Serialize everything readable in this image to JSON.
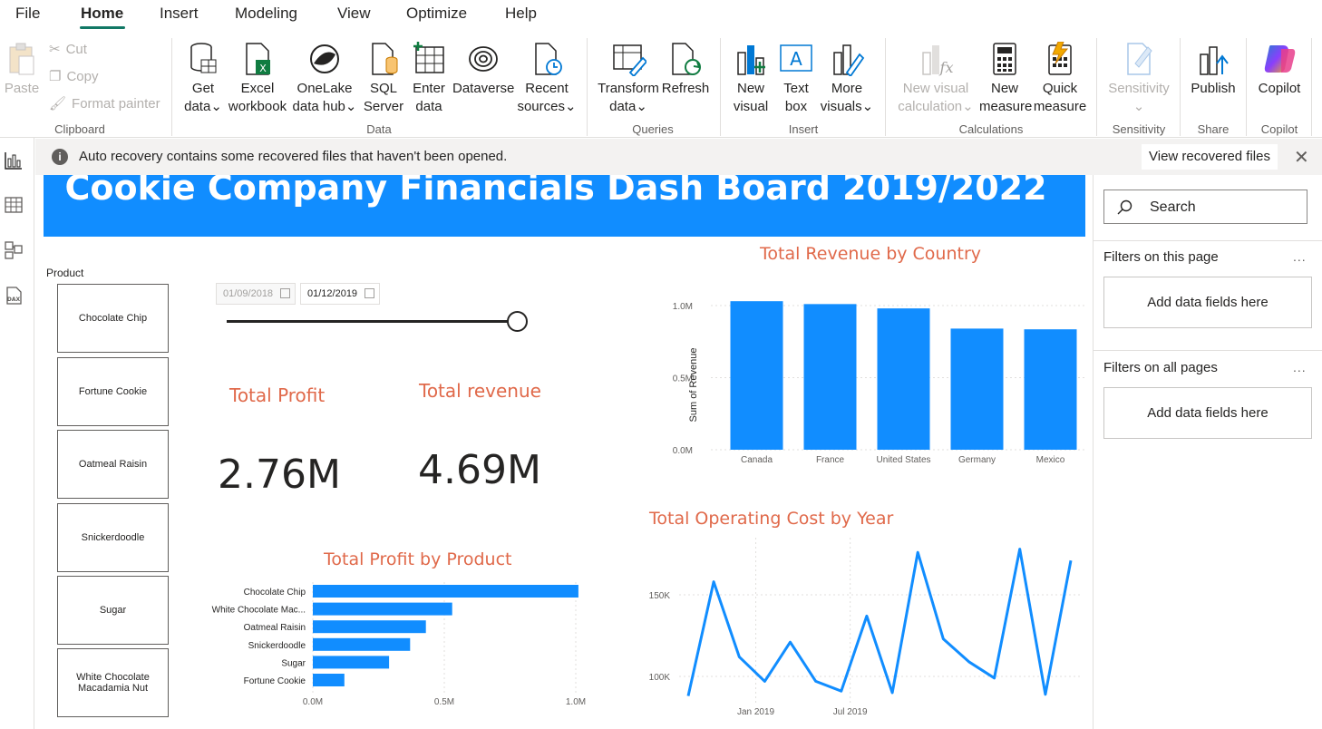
{
  "menu": {
    "items": [
      "File",
      "Home",
      "Insert",
      "Modeling",
      "View",
      "Optimize",
      "Help"
    ],
    "active": "Home"
  },
  "ribbon": {
    "clipboard": {
      "paste": "Paste",
      "cut": "Cut",
      "copy": "Copy",
      "format_painter": "Format painter",
      "group": "Clipboard"
    },
    "data": {
      "get_data": [
        "Get",
        "data"
      ],
      "excel": [
        "Excel",
        "workbook"
      ],
      "onelake": [
        "OneLake",
        "data hub"
      ],
      "sql": [
        "SQL",
        "Server"
      ],
      "enter": [
        "Enter",
        "data"
      ],
      "dataverse": "Dataverse",
      "recent": [
        "Recent",
        "sources"
      ],
      "group": "Data"
    },
    "queries": {
      "transform": [
        "Transform",
        "data"
      ],
      "refresh": "Refresh",
      "group": "Queries"
    },
    "insert": {
      "new_visual": [
        "New",
        "visual"
      ],
      "text_box": [
        "Text",
        "box"
      ],
      "more_visuals": [
        "More",
        "visuals"
      ],
      "group": "Insert"
    },
    "calculations": {
      "new_visual_calc": [
        "New visual",
        "calculation"
      ],
      "new_measure": [
        "New",
        "measure"
      ],
      "quick_measure": [
        "Quick",
        "measure"
      ],
      "group": "Calculations"
    },
    "sensitivity": {
      "label": "Sensitivity",
      "group": "Sensitivity"
    },
    "share": {
      "publish": "Publish",
      "group": "Share"
    },
    "copilot": {
      "label": "Copilot",
      "group": "Copilot"
    }
  },
  "notification": {
    "icon": "info-icon",
    "text": "Auto recovery contains some recovered files that haven't been opened.",
    "button": "View recovered files"
  },
  "report": {
    "title": "Cookie Company Financials Dash Board 2019/2022",
    "slicer": {
      "title": "Product",
      "items": [
        "Chocolate Chip",
        "Fortune Cookie",
        "Oatmeal Raisin",
        "Snickerdoodle",
        "Sugar",
        "White Chocolate Macadamia Nut"
      ]
    },
    "date_range": {
      "start": "01/09/2018",
      "end": "01/12/2019"
    },
    "cards": [
      {
        "title": "Total Profit",
        "value": "2.76M"
      },
      {
        "title": "Total revenue",
        "value": "4.69M"
      }
    ]
  },
  "pane": {
    "search": "Search",
    "filters_page": "Filters on this page",
    "filters_all": "Filters on all pages",
    "add_fields": "Add data fields here",
    "more": "..."
  },
  "colors": {
    "accent": "#118dff",
    "title": "#e0694a",
    "ribbon_underline": "#117865"
  },
  "chart_data": [
    {
      "type": "bar",
      "title": "Total Revenue by Country",
      "categories": [
        "Canada",
        "France",
        "United States",
        "Germany",
        "Mexico"
      ],
      "values": [
        1030000,
        1010000,
        980000,
        840000,
        835000
      ],
      "ylabel": "Sum of Revenue",
      "ylim": [
        0,
        1050000
      ],
      "yticks": [
        "0.0M",
        "0.5M",
        "1.0M"
      ],
      "grid": true
    },
    {
      "type": "bar",
      "orientation": "horizontal",
      "title": "Total Profit by Product",
      "categories": [
        "Chocolate Chip",
        "White Chocolate Mac...",
        "Oatmeal Raisin",
        "Snickerdoodle",
        "Sugar",
        "Fortune Cookie"
      ],
      "values": [
        1010000,
        530000,
        430000,
        370000,
        290000,
        120000
      ],
      "xlim": [
        0,
        1000000
      ],
      "xticks": [
        "0.0M",
        "0.5M",
        "1.0M"
      ],
      "grid": true
    },
    {
      "type": "line",
      "title": "Total Operating Cost by Year",
      "series": [
        {
          "values": [
            88000,
            158000,
            112000,
            97000,
            121000,
            97000,
            91000,
            137000,
            90000,
            176000,
            123000,
            109000,
            99000,
            178000,
            89000,
            171000
          ]
        }
      ],
      "ylim": [
        85000,
        185000
      ],
      "yticks": [
        "100K",
        "150K"
      ],
      "xticks": [
        "Jan 2019",
        "Jul 2019"
      ],
      "grid": true
    }
  ]
}
